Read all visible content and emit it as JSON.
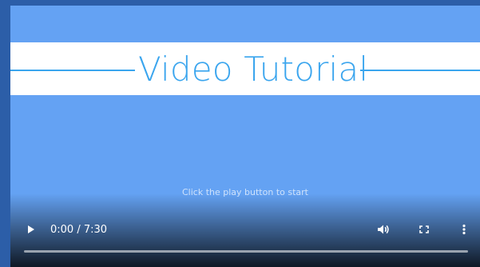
{
  "video": {
    "title": "Video Tutorial",
    "hint": "Click the play button to start",
    "current_time": "0:00",
    "duration": "7:30",
    "time_display": "0:00 / 7:30",
    "progress_fraction": 0,
    "controls": {
      "play_icon": "play-icon",
      "volume_icon": "volume-icon",
      "fullscreen_icon": "fullscreen-icon",
      "more_icon": "more-options-icon"
    }
  },
  "colors": {
    "frame": "#2c5ea8",
    "video_background": "#64a2f3",
    "title_band": "#ffffff",
    "title_accent": "#3aa5ee"
  }
}
